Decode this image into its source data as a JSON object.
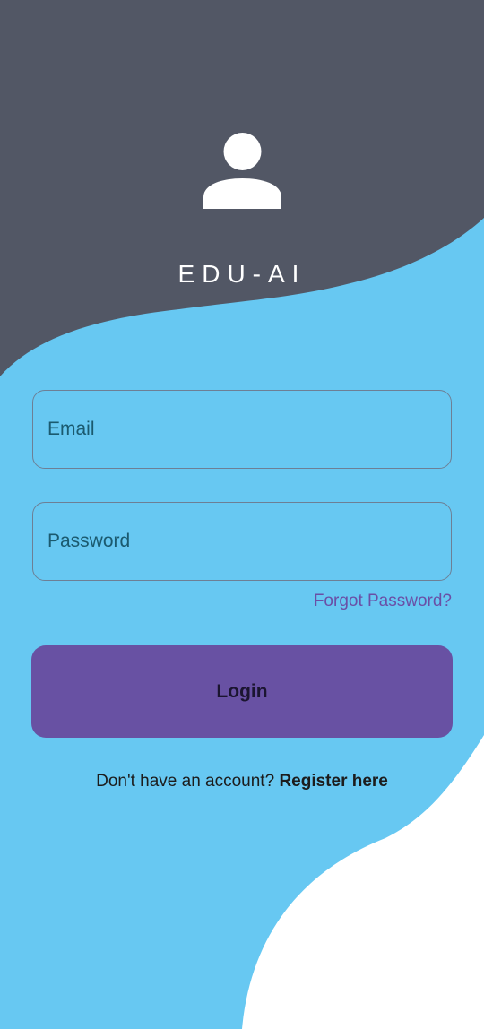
{
  "app": {
    "title": "EDU-AI",
    "icon": "user-avatar-icon"
  },
  "form": {
    "email_placeholder": "Email",
    "password_placeholder": "Password",
    "forgot_password": "Forgot Password?",
    "login_label": "Login"
  },
  "register": {
    "prompt": "Don't have an account? ",
    "link": "Register here"
  },
  "colors": {
    "background_top": "#525765",
    "background_main": "#67c8f2",
    "background_bottom": "#ffffff",
    "accent": "#6851a3",
    "link": "#6a4fa6"
  }
}
